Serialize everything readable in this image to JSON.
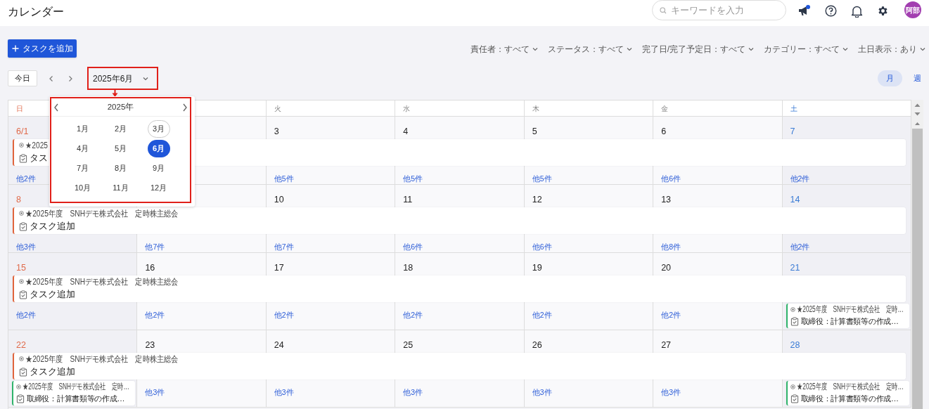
{
  "header": {
    "title": "カレンダー",
    "search": {
      "placeholder": "キーワードを入力"
    },
    "avatar": "阿部"
  },
  "add_button": "タスクを追加",
  "filters": [
    "責任者：すべて",
    "ステータス：すべて",
    "完了日/完了予定日：すべて",
    "カテゴリー：すべて",
    "土日表示：あり"
  ],
  "toolbar": {
    "today": "今日",
    "month_select": "2025年6月"
  },
  "view_tabs": [
    {
      "label": "月",
      "selected": true
    },
    {
      "label": "週",
      "selected": false
    }
  ],
  "month_picker": {
    "year": "2025年",
    "months": [
      {
        "label": "1月",
        "selected": false,
        "current": false
      },
      {
        "label": "2月",
        "selected": false,
        "current": false
      },
      {
        "label": "3月",
        "selected": false,
        "current": true
      },
      {
        "label": "4月",
        "selected": false,
        "current": false
      },
      {
        "label": "5月",
        "selected": false,
        "current": false
      },
      {
        "label": "6月",
        "selected": true,
        "current": false
      },
      {
        "label": "7月",
        "selected": false,
        "current": false
      },
      {
        "label": "8月",
        "selected": false,
        "current": false
      },
      {
        "label": "9月",
        "selected": false,
        "current": false
      },
      {
        "label": "10月",
        "selected": false,
        "current": false
      },
      {
        "label": "11月",
        "selected": false,
        "current": false
      },
      {
        "label": "12月",
        "selected": false,
        "current": false
      }
    ]
  },
  "calendar": {
    "weekdays": [
      {
        "label": "日"
      },
      {
        "covered": true
      },
      {
        "label": "火"
      },
      {
        "label": "水"
      },
      {
        "label": "木"
      },
      {
        "label": "金"
      },
      {
        "label": "土"
      }
    ],
    "weeks": [
      {
        "dates": [
          {
            "date": "6/1"
          },
          {
            "covered": true
          },
          {
            "date": "3"
          },
          {
            "date": "4"
          },
          {
            "date": "5"
          },
          {
            "date": "6"
          },
          {
            "date": "7"
          }
        ],
        "bars": [
          {
            "meta": "★2025",
            "title": "タス",
            "color": "#e0643c"
          }
        ],
        "cells": [
          {
            "more": "他2件"
          },
          {
            "covered": true
          },
          {
            "more": "他5件"
          },
          {
            "more": "他5件"
          },
          {
            "more": "他5件"
          },
          {
            "more": "他6件"
          },
          {
            "more": "他2件"
          }
        ]
      },
      {
        "dates": [
          {
            "date": "8"
          },
          {
            "covered": true
          },
          {
            "date": "10"
          },
          {
            "date": "11"
          },
          {
            "date": "12"
          },
          {
            "date": "13"
          },
          {
            "date": "14"
          }
        ],
        "bars": [
          {
            "meta": "★2025年度　SNHデモ株式会社　定時株主総会",
            "title": "タスク追加",
            "color": "#e0643c"
          }
        ],
        "cells": [
          {
            "more": "他3件"
          },
          {
            "more": "他7件"
          },
          {
            "more": "他7件"
          },
          {
            "more": "他6件"
          },
          {
            "more": "他6件"
          },
          {
            "more": "他8件"
          },
          {
            "more": "他2件"
          }
        ]
      },
      {
        "dates": [
          {
            "date": "15"
          },
          {
            "date": "16"
          },
          {
            "date": "17"
          },
          {
            "date": "18"
          },
          {
            "date": "19"
          },
          {
            "date": "20"
          },
          {
            "date": "21"
          }
        ],
        "bars": [
          {
            "meta": "★2025年度　SNHデモ株式会社　定時株主総会",
            "title": "タスク追加",
            "color": "#e0643c"
          }
        ],
        "cells": [
          {
            "more": "他2件"
          },
          {
            "more": "他2件"
          },
          {
            "more": "他2件"
          },
          {
            "more": "他2件"
          },
          {
            "more": "他2件"
          },
          {
            "more": "他2件"
          },
          {
            "event": {
              "meta": "★2025年度　SNHデモ株式会社　定時…",
              "title": "取締役：計算書類等の作成…",
              "color": "#2fb36b"
            }
          }
        ]
      },
      {
        "dates": [
          {
            "date": "22"
          },
          {
            "date": "23"
          },
          {
            "date": "24"
          },
          {
            "date": "25"
          },
          {
            "date": "26"
          },
          {
            "date": "27"
          },
          {
            "date": "28"
          }
        ],
        "bars": [
          {
            "meta": "★2025年度　SNHデモ株式会社　定時株主総会",
            "title": "タスク追加",
            "color": "#e0643c"
          }
        ],
        "cells": [
          {
            "event": {
              "meta": "★2025年度　SNHデモ株式会社　定時…",
              "title": "取締役：計算書類等の作成…",
              "color": "#2fb36b"
            }
          },
          {
            "more": "他3件"
          },
          {
            "more": "他3件"
          },
          {
            "more": "他3件"
          },
          {
            "more": "他3件"
          },
          {
            "more": "他3件"
          },
          {
            "event": {
              "meta": "★2025年度　SNHデモ株式会社　定時…",
              "title": "取締役：計算書類等の作成…",
              "color": "#2fb36b"
            }
          }
        ]
      }
    ]
  }
}
